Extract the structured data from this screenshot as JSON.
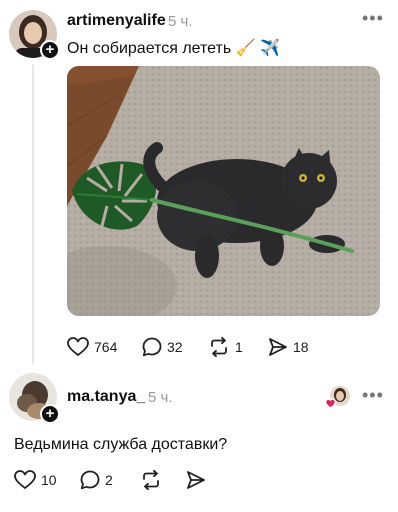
{
  "post": {
    "username": "artimenyalife",
    "time": "5 ч.",
    "caption": "Он собирается лететь 🧹 ✈️",
    "stats": {
      "likes": "764",
      "comments": "32",
      "reposts": "1",
      "shares": "18"
    }
  },
  "reply": {
    "username": "ma.tanya_",
    "time": "5 ч.",
    "text": "Ведьмина служба доставки?",
    "stats": {
      "likes": "10",
      "comments": "2"
    }
  },
  "icons": {
    "more": "more-icon",
    "like": "heart-icon",
    "comment": "comment-icon",
    "repost": "repost-icon",
    "share": "share-icon"
  },
  "colors": {
    "text": "#101010",
    "muted": "#999999",
    "heart": "#e0245e"
  }
}
